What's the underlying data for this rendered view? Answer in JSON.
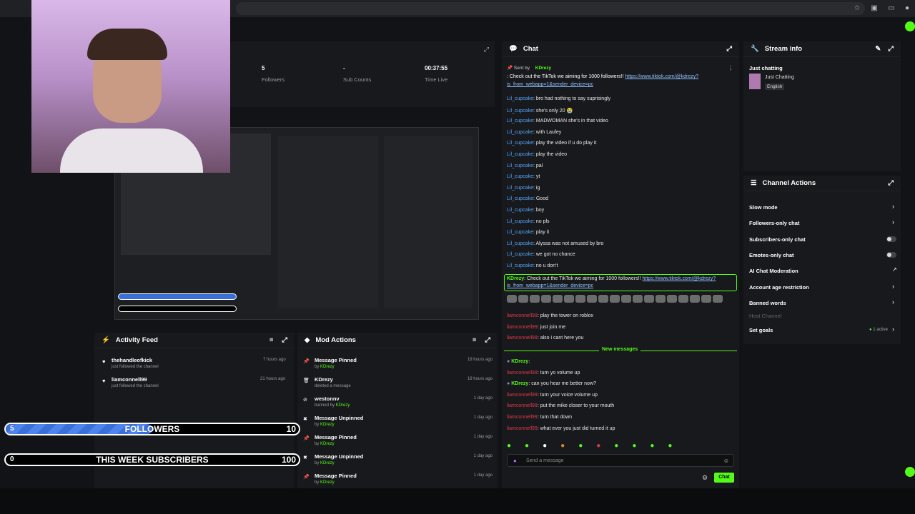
{
  "stats": {
    "followers_value": "5",
    "followers_label": "Followers",
    "subs_value": "-",
    "subs_label": "Sub Counts",
    "time_value": "00:37:55",
    "time_label": "Time Live"
  },
  "chat": {
    "title": "Chat",
    "pinned_prefix": "Sent by",
    "pinned_user": "KDrezy",
    "pinned_text": ": Check out the TikTok we aiming for 1000 followers!!",
    "pinned_link1": "https://www.tiktok.com/@kdrezy?",
    "pinned_link2": "is_from_webapp=1&sender_device=pc",
    "messages": [
      {
        "user": "Lil_cupcake",
        "text": ": bro had nothing to say suprisingly"
      },
      {
        "user": "Lil_cupcake",
        "text": ": she's only 20 😭"
      },
      {
        "user": "Lil_cupcake",
        "text": ": MADWOMAN she's in that video"
      },
      {
        "user": "Lil_cupcake",
        "text": ": with Laufey"
      },
      {
        "user": "Lil_cupcake",
        "text": ": play the video if u do play it"
      },
      {
        "user": "Lil_cupcake",
        "text": ": play the video"
      },
      {
        "user": "Lil_cupcake",
        "text": ": pal"
      },
      {
        "user": "Lil_cupcake",
        "text": ": yt"
      },
      {
        "user": "Lil_cupcake",
        "text": ": ig"
      },
      {
        "user": "Lil_cupcake",
        "text": ": Good"
      },
      {
        "user": "Lil_cupcake",
        "text": ": boy"
      },
      {
        "user": "Lil_cupcake",
        "text": ": no pls"
      },
      {
        "user": "Lil_cupcake",
        "text": ": play it"
      },
      {
        "user": "Lil_cupcake",
        "text": ": Alyssa was not amused by bro"
      },
      {
        "user": "Lil_cupcake",
        "text": ": we got no chance"
      },
      {
        "user": "Lil_cupcake",
        "text": ": no u don't"
      }
    ],
    "highlight_user": "KDrezy",
    "highlight_text": ": Check out the TikTok we aiming for 1000 followers!!",
    "highlight_link1": "https://www.tiktok.com/@kdrezy?",
    "highlight_link2": "is_from_webapp=1&sender_device=pc",
    "later": [
      {
        "user": "liamconnell99",
        "text": ": play the tower on roblox"
      },
      {
        "user": "liamconnell99",
        "text": ": just join me"
      },
      {
        "user": "liamconnell99",
        "text": ": also i cant here you"
      }
    ],
    "new_messages": "New messages",
    "recent": [
      {
        "user": "KDrezy",
        "text": ":",
        "kind": "k"
      },
      {
        "user": "liamconnell99",
        "text": ": turn yo volume up",
        "kind": "r"
      },
      {
        "user": "KDrezy",
        "text": ": can you hear me better now?",
        "kind": "k"
      },
      {
        "user": "liamconnell99",
        "text": ": turn your voice volume up",
        "kind": "r"
      },
      {
        "user": "liamconnell99",
        "text": ": put the mike closer to your mouth",
        "kind": "r"
      },
      {
        "user": "liamconnell99",
        "text": ": turn that down",
        "kind": "r"
      },
      {
        "user": "liamconnell99",
        "text": ": what ever you just did turned it up",
        "kind": "r"
      }
    ],
    "input_placeholder": "Send a message",
    "send_label": "Chat"
  },
  "stream_info": {
    "title": "Stream info",
    "stream_title": "Just chatting",
    "category": "Just Chatting",
    "language": "English"
  },
  "channel_actions": {
    "title": "Channel Actions",
    "items": [
      "Slow mode",
      "Followers-only chat",
      "Subscribers-only chat",
      "Emotes-only chat",
      "AI Chat Moderation",
      "Account age restriction",
      "Banned words",
      "Host Channel",
      "Set goals"
    ],
    "set_goals_status": "1 active"
  },
  "activity": {
    "title": "Activity Feed",
    "items": [
      {
        "user": "thehandleofkick",
        "sub": "just followed the channel",
        "time": "7 hours ago"
      },
      {
        "user": "liamconnell99",
        "sub": "just followed the channel",
        "time": "21 hours ago"
      }
    ]
  },
  "mod": {
    "title": "Mod Actions",
    "items": [
      {
        "title": "Message Pinned",
        "by_prefix": "by",
        "by": "KDrezy",
        "time": "19 hours ago"
      },
      {
        "title": "KDrezy",
        "sub": "deleted a message",
        "time": "19 hours ago"
      },
      {
        "title": "westonnv",
        "by_prefix": "banned by",
        "by": "KDrezy",
        "time": "1 day ago"
      },
      {
        "title": "Message Unpinned",
        "by_prefix": "by",
        "by": "KDrezy",
        "time": "1 day ago"
      },
      {
        "title": "Message Pinned",
        "by_prefix": "by",
        "by": "KDrezy",
        "time": "1 day ago"
      },
      {
        "title": "Message Unpinned",
        "by_prefix": "by",
        "by": "KDrezy",
        "time": "1 day ago"
      },
      {
        "title": "Message Pinned",
        "by_prefix": "by",
        "by": "KDrezy",
        "time": "1 day ago"
      }
    ]
  },
  "goals": {
    "followers": {
      "current": "5",
      "label": "FOLLOWERS",
      "target": "10",
      "fraction": 0.5
    },
    "subs": {
      "current": "0",
      "label": "THIS WEEK SUBSCRIBERS",
      "target": "100",
      "fraction": 0
    }
  },
  "colors": {
    "accent": "#53fc18",
    "bar_fill": "#3b6fd8"
  }
}
